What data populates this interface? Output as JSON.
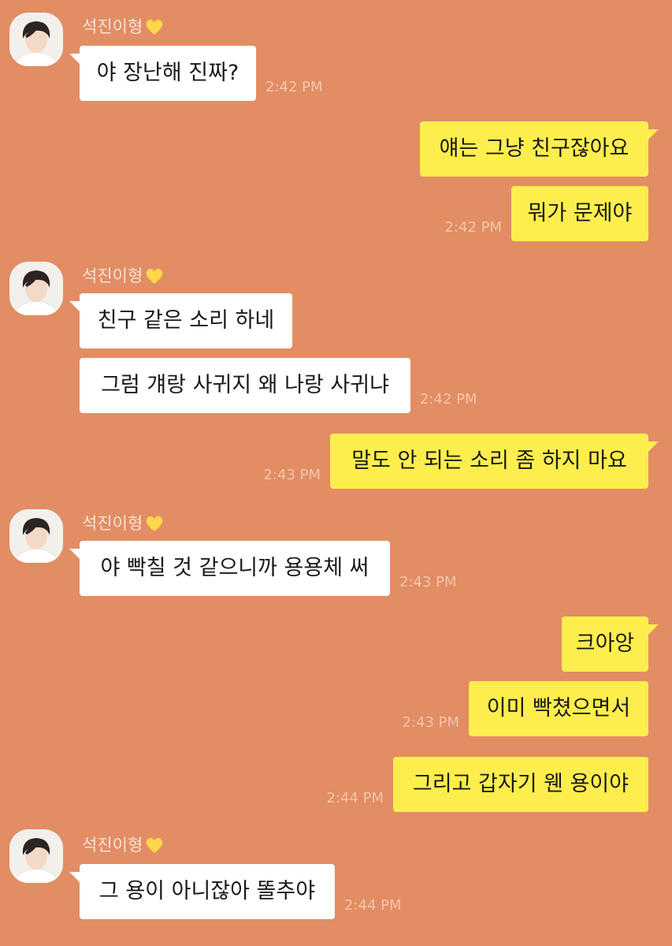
{
  "contact": {
    "name": "석진이형"
  },
  "colors": {
    "background": "#e28d64",
    "incoming_bubble": "#ffffff",
    "outgoing_bubble": "#fdee4d",
    "heart": "#ffd84a"
  },
  "messages": [
    {
      "side": "in",
      "text": "야 장난해 진짜?",
      "time": "2:42 PM",
      "show_sender": true
    },
    {
      "side": "out",
      "text": "얘는 그냥 친구잖아요",
      "time": ""
    },
    {
      "side": "out",
      "text": "뭐가 문제야",
      "time": "2:42 PM"
    },
    {
      "side": "in",
      "text": "친구 같은 소리 하네",
      "time": "",
      "show_sender": true
    },
    {
      "side": "in",
      "text": "그럼 걔랑 사귀지 왜 나랑 사귀냐",
      "time": "2:42 PM"
    },
    {
      "side": "out",
      "text": "말도 안 되는 소리 좀 하지 마요",
      "time": "2:43 PM"
    },
    {
      "side": "in",
      "text": "야 빡칠 것 같으니까 용용체 써",
      "time": "2:43 PM",
      "show_sender": true
    },
    {
      "side": "out",
      "text": "크아앙",
      "time": ""
    },
    {
      "side": "out",
      "text": "이미 빡쳤으면서",
      "time": "2:43 PM"
    },
    {
      "side": "out",
      "text": "그리고 갑자기 웬 용이야",
      "time": "2:44 PM"
    },
    {
      "side": "in",
      "text": "그 용이 아니잖아 똘추야",
      "time": "2:44 PM",
      "show_sender": true
    }
  ]
}
